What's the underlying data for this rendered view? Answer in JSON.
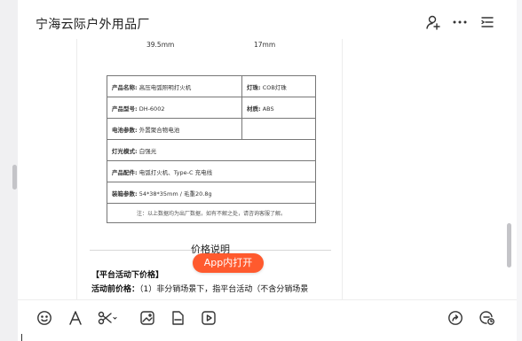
{
  "header": {
    "title": "宁海云际户外用品厂"
  },
  "document": {
    "dimensions": [
      "39.5mm",
      "17mm"
    ],
    "spec_table": [
      {
        "label": "产品名称:",
        "value": "高压电弧照明打火机",
        "label2": "灯珠:",
        "value2": "COB灯珠"
      },
      {
        "label": "产品型号:",
        "value": "DH-6002",
        "label2": "材质:",
        "value2": "ABS"
      },
      {
        "label": "电池参数:",
        "value": "外置聚合物电池",
        "label2": "",
        "value2": ""
      },
      {
        "label": "灯光模式:",
        "value": "白强光"
      },
      {
        "label": "产品配件:",
        "value": "电弧打火机、Type-C 充电线"
      },
      {
        "label": "装箱参数:",
        "value": "54*38*35mm / 毛重20.8g"
      }
    ],
    "note": "注：以上数据均为出厂数据，如有不解之处，请咨询客服了解。",
    "section_title": "价格说明",
    "activity_title": "【平台活动下价格】",
    "activity_label": "活动前价格：",
    "activity_text": "（1）非分销场景下，指平台活动（不含分销场景"
  },
  "open_app_label": "App内打开",
  "icons": {
    "header": [
      "user-add-icon",
      "more-icon",
      "list-icon"
    ],
    "toolbar_left": [
      "emoji-icon",
      "font-icon",
      "scissors-icon",
      "image-icon",
      "file-icon",
      "video-icon"
    ],
    "toolbar_right": [
      "share-icon",
      "history-icon"
    ]
  },
  "colors": {
    "accent": "#ff5a2e",
    "icon": "#333333"
  }
}
